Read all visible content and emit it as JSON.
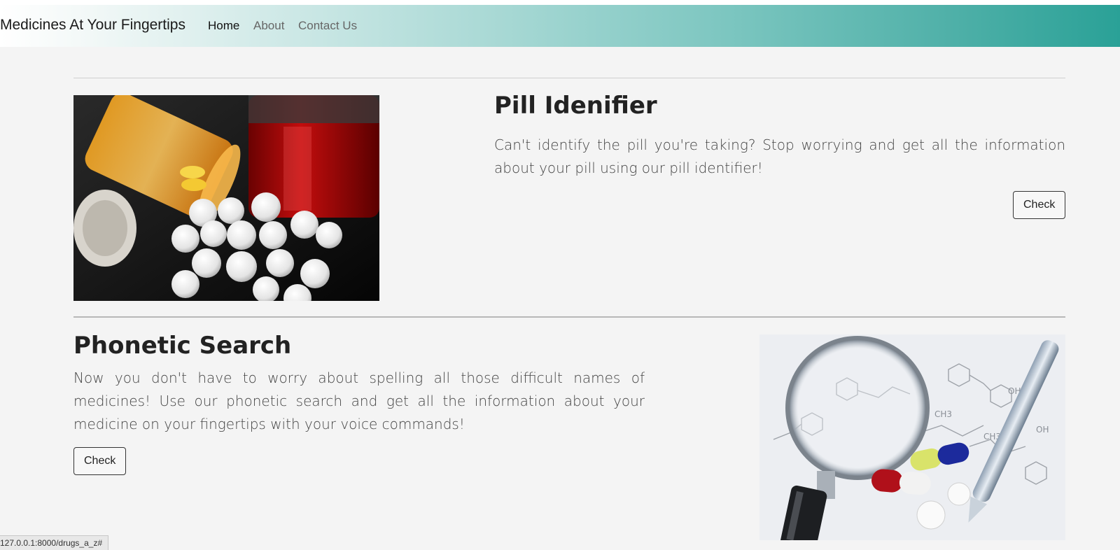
{
  "navbar": {
    "brand": "Medicines At Your Fingertips",
    "links": [
      {
        "label": "Home",
        "active": true
      },
      {
        "label": "About",
        "active": false
      },
      {
        "label": "Contact Us",
        "active": false
      }
    ],
    "gradient": [
      "#ffffff",
      "#2aa197"
    ]
  },
  "pill_section": {
    "title": "Pill Idenifier",
    "description": "Can't identify the pill you're taking? Stop worrying and get all the information about your pill using our pill identifier!",
    "button_label": "Check",
    "image": "pills-bottle-photo"
  },
  "phonetic_section": {
    "title": "Phonetic Search",
    "description": "Now you don't have to worry about spelling all those difficult names of medicines! Use our phonetic search and get all the information about your medicine on your fingertips with your voice commands!",
    "button_label": "Check",
    "image": "magnifying-glass-chemistry-photo"
  },
  "status_url": "127.0.0.1:8000/drugs_a_z#",
  "colors": {
    "page_bg": "#f4f4f4",
    "accent": "#2aa197"
  }
}
